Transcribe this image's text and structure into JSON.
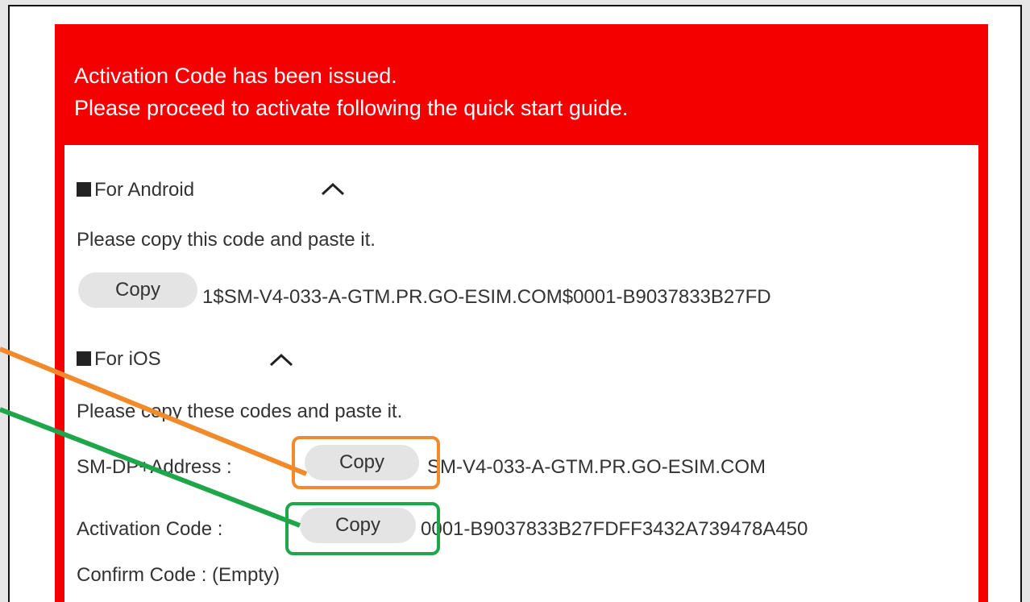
{
  "banner": {
    "line1": "Activation Code has been issued.",
    "line2": "Please proceed to activate following the quick start guide."
  },
  "android": {
    "title": "For Android",
    "instruction": "Please copy this code and paste it.",
    "copy_label": "Copy",
    "code": "1$SM-V4-033-A-GTM.PR.GO-ESIM.COM$0001-B9037833B27FD"
  },
  "ios": {
    "title": "For iOS",
    "instruction": "Please copy these codes and paste it.",
    "smdp_label": "SM-DP+Address :",
    "smdp_copy_label": "Copy",
    "smdp_value": "SM-V4-033-A-GTM.PR.GO-ESIM.COM",
    "activation_label": "Activation Code :",
    "activation_copy_label": "Copy",
    "activation_value": "0001-B9037833B27FDFF3432A739478A450",
    "confirm_text": "Confirm Code : (Empty)"
  },
  "colors": {
    "banner_red": "#f40000",
    "highlight_orange": "#f08a2a",
    "highlight_green": "#1fa64a"
  }
}
